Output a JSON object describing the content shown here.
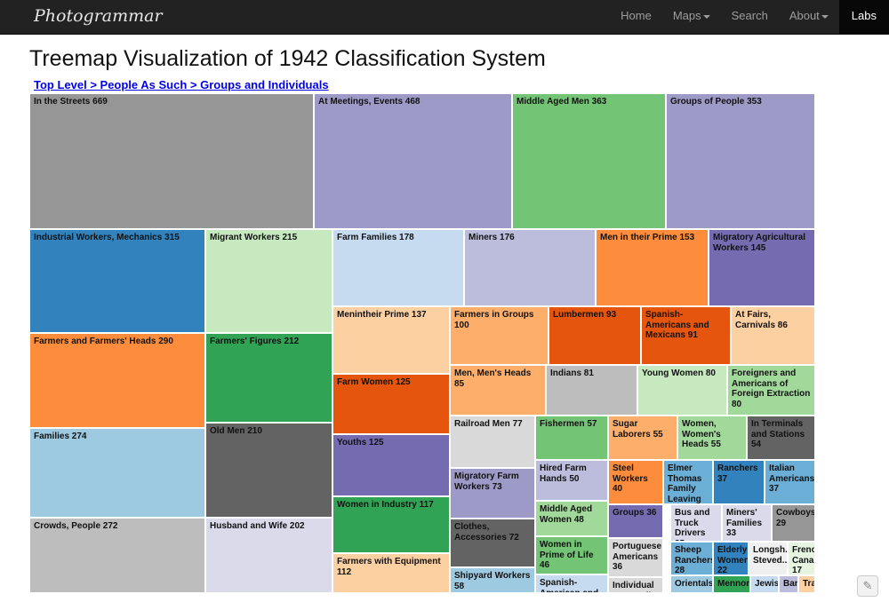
{
  "brand": "Photogrammar",
  "nav": {
    "home": "Home",
    "maps": "Maps",
    "search": "Search",
    "about": "About",
    "labs": "Labs"
  },
  "title": "Treemap Visualization of 1942 Classification System",
  "breadcrumb": "Top Level > People As Such > Groups and Individuals",
  "cells": [
    {
      "label": "In the Streets 669",
      "color": "#969696"
    },
    {
      "label": "At Meetings, Events 468",
      "color": "#9e9ac8"
    },
    {
      "label": "Middle Aged Men 363",
      "color": "#74c476"
    },
    {
      "label": "Groups of People 353",
      "color": "#9e9ac8"
    },
    {
      "label": "Industrial Workers, Mechanics 315",
      "color": "#3182bd"
    },
    {
      "label": "Migrant Workers 215",
      "color": "#c7e9c0"
    },
    {
      "label": "Farm Families 178",
      "color": "#c6dbef"
    },
    {
      "label": "Miners 176",
      "color": "#bcbddc"
    },
    {
      "label": "Men in their Prime 153",
      "color": "#fd8d3c"
    },
    {
      "label": "Migratory Agricultural Workers 145",
      "color": "#756bb1"
    },
    {
      "label": "Farmers and Farmers' Heads 290",
      "color": "#fd8d3c"
    },
    {
      "label": "Farmers' Figures 212",
      "color": "#31a354"
    },
    {
      "label": "Menintheir Prime 137",
      "color": "#fdd0a2"
    },
    {
      "label": "Farmers in Groups 100",
      "color": "#fdae6b"
    },
    {
      "label": "Lumbermen 93",
      "color": "#e6550d"
    },
    {
      "label": "Spanish-Americans and Mexicans 91",
      "color": "#e6550d"
    },
    {
      "label": "At Fairs, Carnivals 86",
      "color": "#fdd0a2"
    },
    {
      "label": "Farm Women 125",
      "color": "#e6550d"
    },
    {
      "label": "Men, Men's Heads 85",
      "color": "#fdae6b"
    },
    {
      "label": "Indians 81",
      "color": "#bdbdbd"
    },
    {
      "label": "Young Women 80",
      "color": "#c7e9c0"
    },
    {
      "label": "Foreigners and Americans of Foreign Extraction 80",
      "color": "#a1d99b"
    },
    {
      "label": "Families 274",
      "color": "#9ecae1"
    },
    {
      "label": "Old Men 210",
      "color": "#636363"
    },
    {
      "label": "Youths 125",
      "color": "#756bb1"
    },
    {
      "label": "Railroad Men 77",
      "color": "#d9d9d9"
    },
    {
      "label": "Fishermen 57",
      "color": "#74c476"
    },
    {
      "label": "Sugar Laborers 55",
      "color": "#fdae6b"
    },
    {
      "label": "Women, Women's Heads 55",
      "color": "#a1d99b"
    },
    {
      "label": "In Terminals and Stations 54",
      "color": "#636363"
    },
    {
      "label": "Migratory Farm Workers 73",
      "color": "#9e9ac8"
    },
    {
      "label": "Hired Farm Hands 50",
      "color": "#bcbddc"
    },
    {
      "label": "Steel Workers 40",
      "color": "#fd8d3c"
    },
    {
      "label": "Elmer Thomas Family Leaving",
      "color": "#6baed6"
    },
    {
      "label": "Ranchers 37",
      "color": "#3182bd"
    },
    {
      "label": "Italian Americans 37",
      "color": "#6baed6"
    },
    {
      "label": "Women in Industry 117",
      "color": "#31a354"
    },
    {
      "label": "Clothes, Accessories 72",
      "color": "#636363"
    },
    {
      "label": "Middle Aged Women 48",
      "color": "#a1d99b"
    },
    {
      "label": "Groups 36",
      "color": "#756bb1"
    },
    {
      "label": "Bus and Truck Drivers 35",
      "color": "#dadaeb"
    },
    {
      "label": "Miners' Families 33",
      "color": "#dadaeb"
    },
    {
      "label": "Cowboys 29",
      "color": "#969696"
    },
    {
      "label": "Crowds, People 272",
      "color": "#bdbdbd"
    },
    {
      "label": "Husband and Wife 202",
      "color": "#dadaeb"
    },
    {
      "label": "Farmers with Equipment 112",
      "color": "#fdd0a2"
    },
    {
      "label": "Women in Prime of Life 46",
      "color": "#74c476"
    },
    {
      "label": "Portuguese Americans 36",
      "color": "#d9d9d9"
    },
    {
      "label": "Sheep Ranchers 28",
      "color": "#6baed6"
    },
    {
      "label": "Elderly Women 22",
      "color": "#3182bd"
    },
    {
      "label": "Longsh..., Steved...",
      "color": "#f0f0f0"
    },
    {
      "label": "French Canad... 17",
      "color": "#e5f5e0"
    },
    {
      "label": "Shipyard Workers 58",
      "color": "#9ecae1"
    },
    {
      "label": "Spanish-American and",
      "color": "#c6dbef"
    },
    {
      "label": "Individual Men, Full",
      "color": "#d9d9d9"
    },
    {
      "label": "Orientals,",
      "color": "#9ecae1"
    },
    {
      "label": "Mennon",
      "color": "#31a354"
    },
    {
      "label": "Jewis",
      "color": "#c6dbef"
    },
    {
      "label": "Ban",
      "color": "#bcbddc"
    },
    {
      "label": "Tra",
      "color": "#fdd0a2"
    }
  ]
}
